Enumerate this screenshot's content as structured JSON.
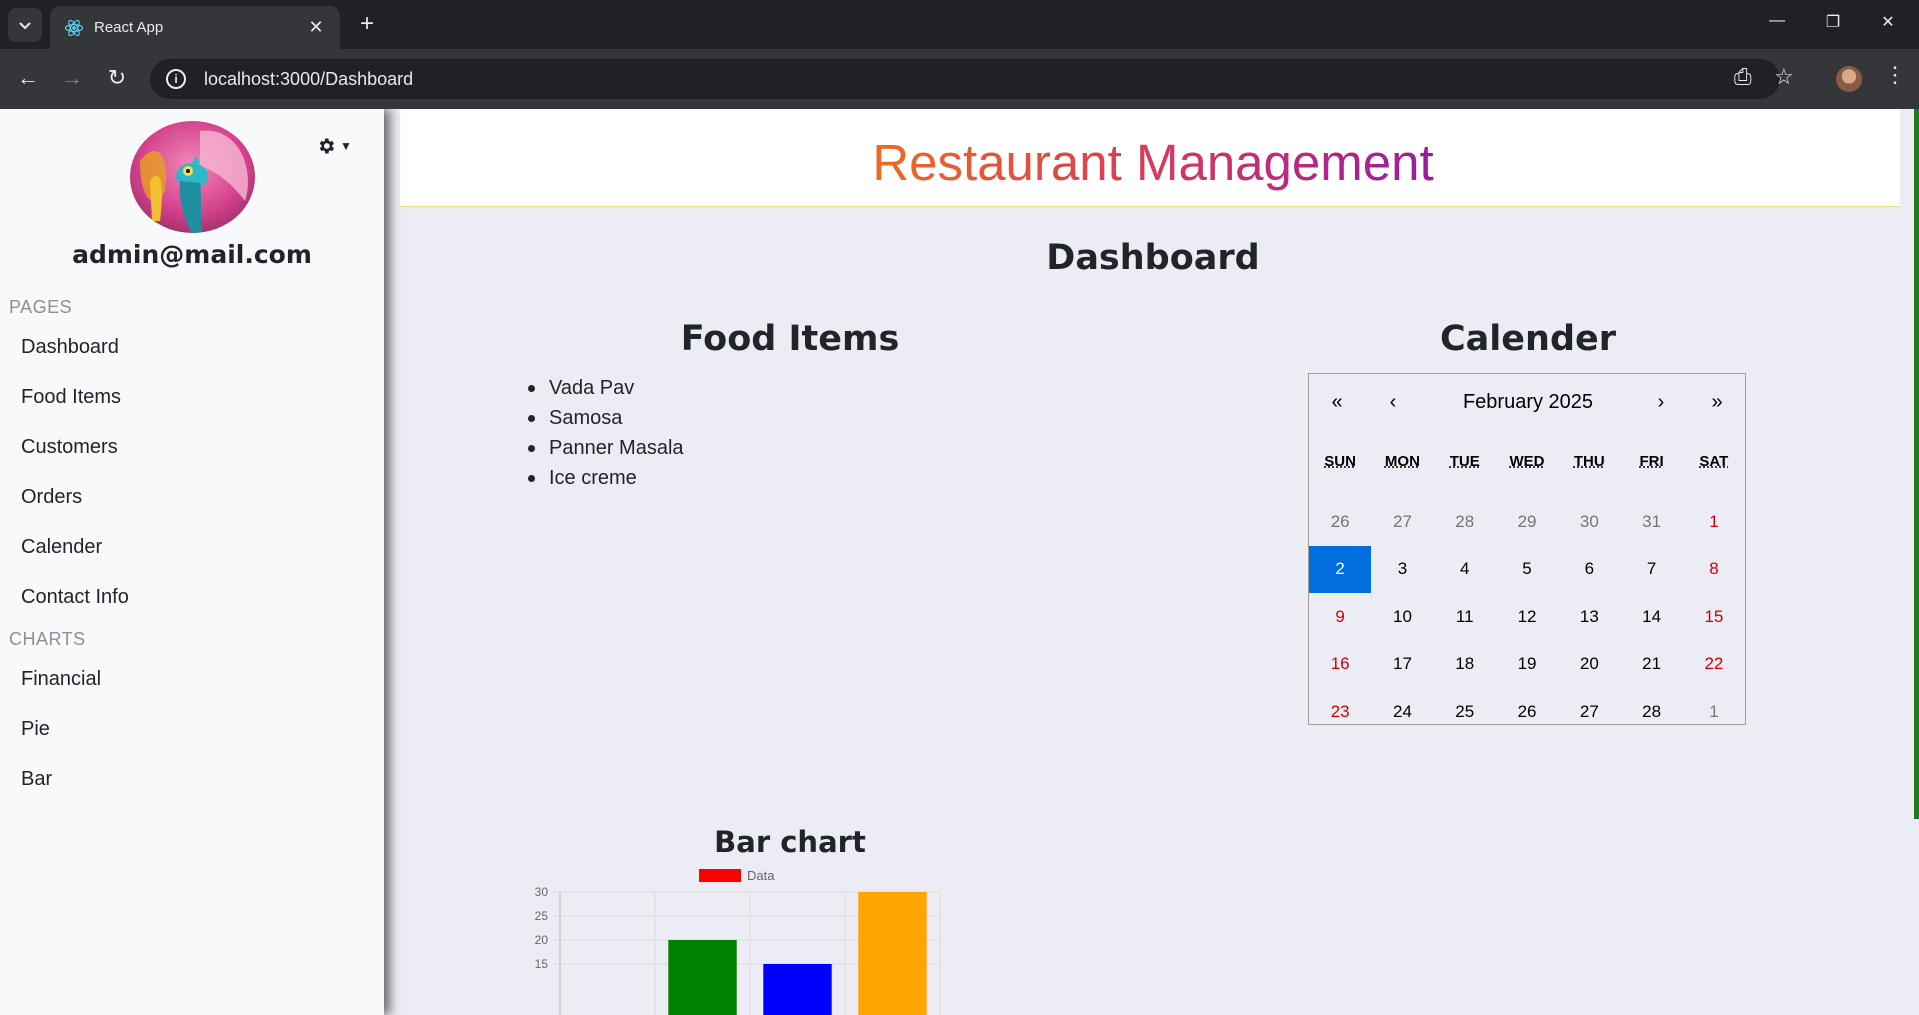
{
  "browser": {
    "tab_title": "React App",
    "url": "localhost:3000/Dashboard"
  },
  "sidebar": {
    "user_email": "admin@mail.com",
    "pages_heading": "PAGES",
    "pages": [
      "Dashboard",
      "Food Items",
      "Customers",
      "Orders",
      "Calender",
      "Contact Info"
    ],
    "charts_heading": "CHARTS",
    "charts": [
      "Financial",
      "Pie",
      "Bar"
    ]
  },
  "header": {
    "app_title": "Restaurant Management"
  },
  "main": {
    "page_title": "Dashboard",
    "food_title": "Food Items",
    "food_items": [
      "Vada Pav",
      "Samosa",
      "Panner Masala",
      "Ice creme"
    ],
    "calendar_title": "Calender",
    "bar_title": "Bar chart"
  },
  "calendar": {
    "nav_prev2": "«",
    "nav_prev": "‹",
    "nav_next": "›",
    "nav_next2": "»",
    "month_label": "February 2025",
    "weekdays": [
      "SUN",
      "MON",
      "TUE",
      "WED",
      "THU",
      "FRI",
      "SAT"
    ],
    "days": [
      {
        "d": "26",
        "t": "neighbor"
      },
      {
        "d": "27",
        "t": "neighbor"
      },
      {
        "d": "28",
        "t": "neighbor"
      },
      {
        "d": "29",
        "t": "neighbor"
      },
      {
        "d": "30",
        "t": "neighbor"
      },
      {
        "d": "31",
        "t": "neighbor"
      },
      {
        "d": "1",
        "t": "weekend"
      },
      {
        "d": "2",
        "t": "active"
      },
      {
        "d": "3",
        "t": ""
      },
      {
        "d": "4",
        "t": ""
      },
      {
        "d": "5",
        "t": ""
      },
      {
        "d": "6",
        "t": ""
      },
      {
        "d": "7",
        "t": ""
      },
      {
        "d": "8",
        "t": "weekend"
      },
      {
        "d": "9",
        "t": "weekend"
      },
      {
        "d": "10",
        "t": ""
      },
      {
        "d": "11",
        "t": ""
      },
      {
        "d": "12",
        "t": ""
      },
      {
        "d": "13",
        "t": ""
      },
      {
        "d": "14",
        "t": ""
      },
      {
        "d": "15",
        "t": "weekend"
      },
      {
        "d": "16",
        "t": "weekend"
      },
      {
        "d": "17",
        "t": ""
      },
      {
        "d": "18",
        "t": ""
      },
      {
        "d": "19",
        "t": ""
      },
      {
        "d": "20",
        "t": ""
      },
      {
        "d": "21",
        "t": ""
      },
      {
        "d": "22",
        "t": "weekend"
      },
      {
        "d": "23",
        "t": "weekend"
      },
      {
        "d": "24",
        "t": ""
      },
      {
        "d": "25",
        "t": ""
      },
      {
        "d": "26",
        "t": ""
      },
      {
        "d": "27",
        "t": ""
      },
      {
        "d": "28",
        "t": ""
      },
      {
        "d": "1",
        "t": "neighbor"
      }
    ]
  },
  "chart_data": {
    "type": "bar",
    "title": "Bar chart",
    "legend": {
      "label": "Data",
      "color": "#ff0000",
      "position": "top"
    },
    "y_ticks": [
      30,
      25,
      20,
      15
    ],
    "ylim_visible": [
      15,
      30
    ],
    "categories": [
      "",
      "",
      "",
      ""
    ],
    "values": [
      null,
      20,
      15,
      30
    ],
    "colors": [
      "#ff0000",
      "#008000",
      "#0000ff",
      "#ffa500"
    ],
    "grid": true
  }
}
